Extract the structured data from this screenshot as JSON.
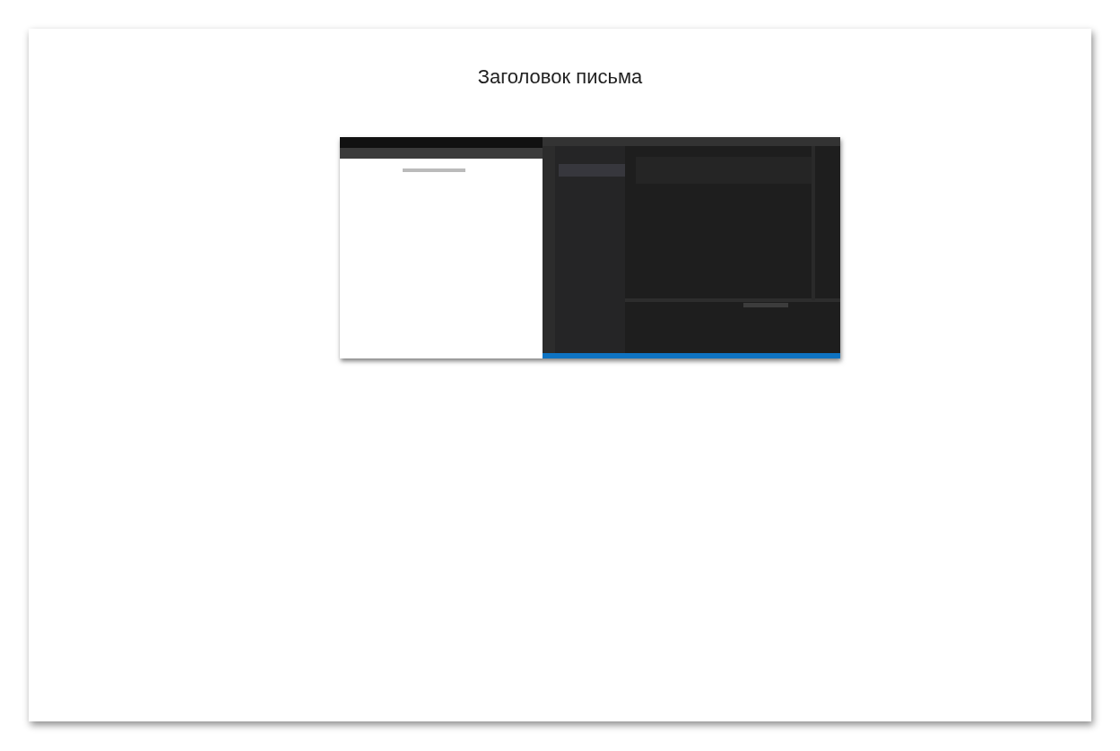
{
  "heading": "Заголовок письма"
}
